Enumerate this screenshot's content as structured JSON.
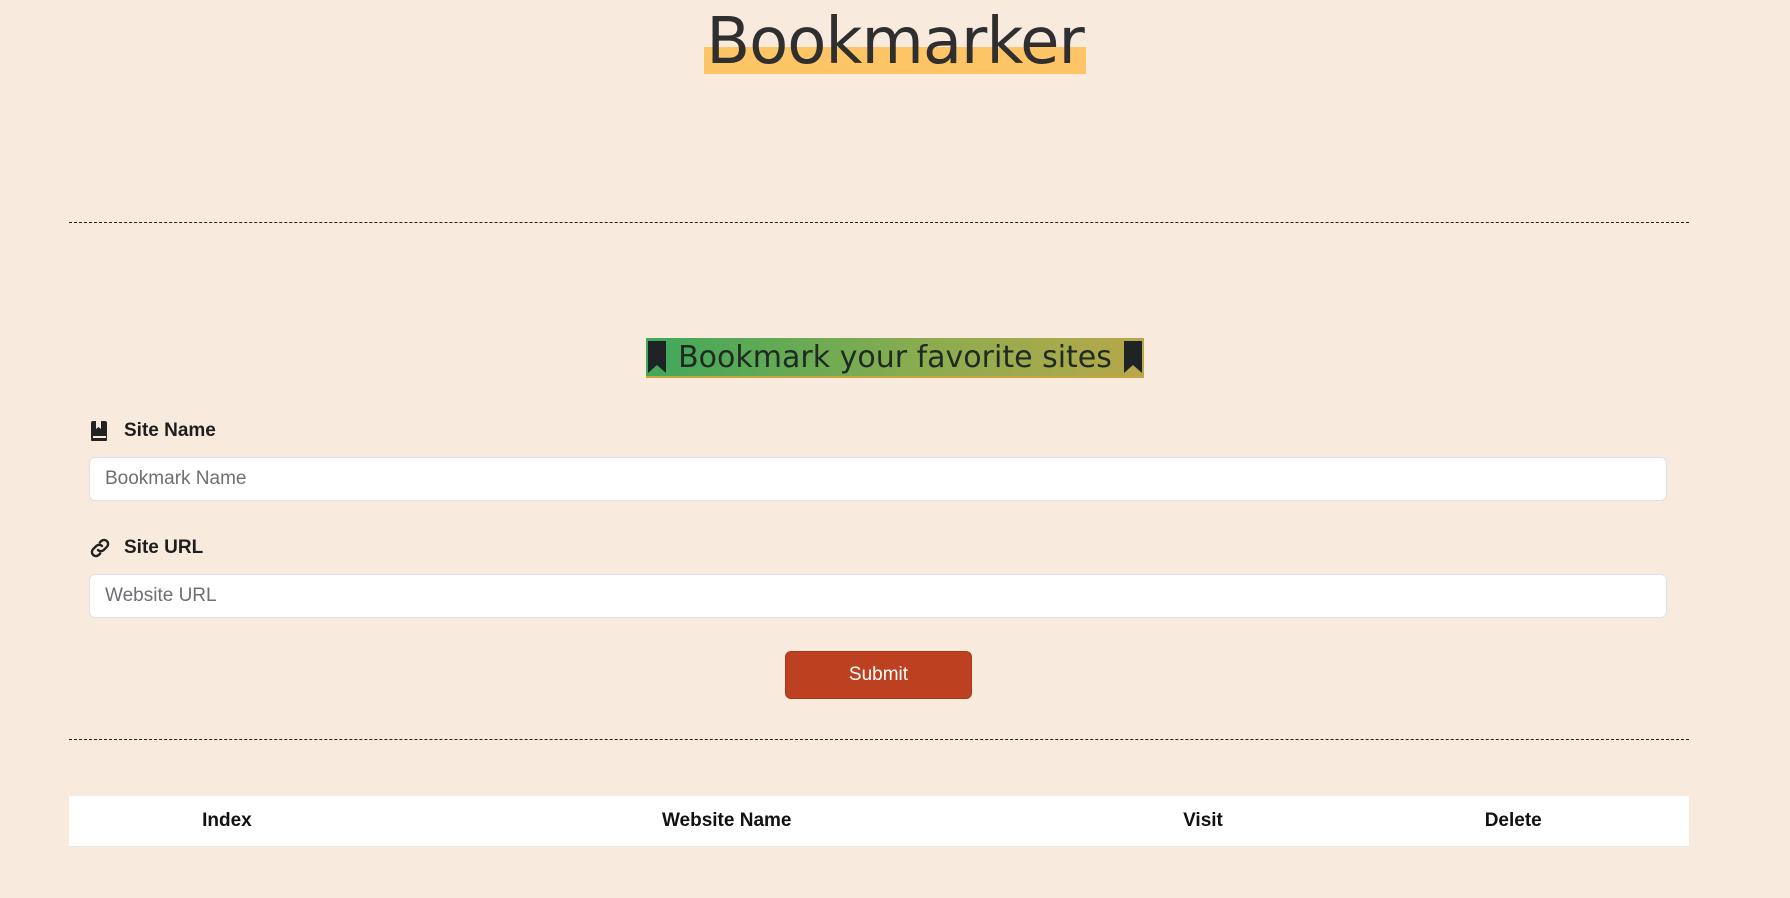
{
  "app": {
    "title": "Bookmarker"
  },
  "form": {
    "heading": "Bookmark your favorite sites",
    "site_name": {
      "label": "Site Name",
      "placeholder": "Bookmark Name",
      "value": "",
      "icon": "book-bookmark-icon"
    },
    "site_url": {
      "label": "Site URL",
      "placeholder": "Website URL",
      "value": "",
      "icon": "link-icon"
    },
    "submit_label": "Submit"
  },
  "table": {
    "columns": [
      "Index",
      "Website Name",
      "Visit",
      "Delete"
    ],
    "rows": []
  },
  "colors": {
    "background": "#f8ebde",
    "title_highlight": "#fdc565",
    "heading_gradient_start": "#3fa85b",
    "heading_gradient_end": "#b7a84a",
    "submit_button": "#bd4120"
  }
}
